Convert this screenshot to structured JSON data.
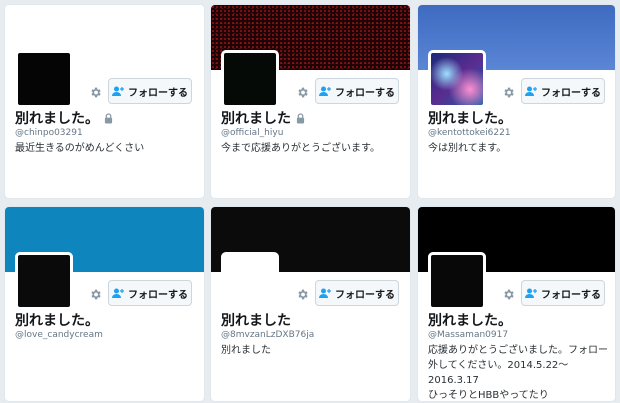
{
  "follow_label": "フォローする",
  "cards": [
    {
      "display_name": "別れました。",
      "handle": "@chinpo03291",
      "bio": [
        "最近生きるのがめんどくさい"
      ],
      "protected": true
    },
    {
      "display_name": "別れました",
      "handle": "@official_hiyu",
      "bio": [
        "今まで応援ありがとうございます。"
      ],
      "protected": true
    },
    {
      "display_name": "別れました。",
      "handle": "@kentottokei6221",
      "bio": [
        "今は別れてます。"
      ],
      "protected": false
    },
    {
      "display_name": "別れました。",
      "handle": "@love_candycream",
      "bio": [],
      "protected": false
    },
    {
      "display_name": "別れました",
      "handle": "@8mvzanLzDXB76ja",
      "bio": [
        "別れました"
      ],
      "protected": false
    },
    {
      "display_name": "別れました。",
      "handle": "@Massaman0917",
      "bio": [
        "応援ありがとうございました。フォロー",
        "外してください。2014.5.22〜2016.3.17",
        "ひっそりとHBBやってたり"
      ],
      "protected": false
    }
  ]
}
